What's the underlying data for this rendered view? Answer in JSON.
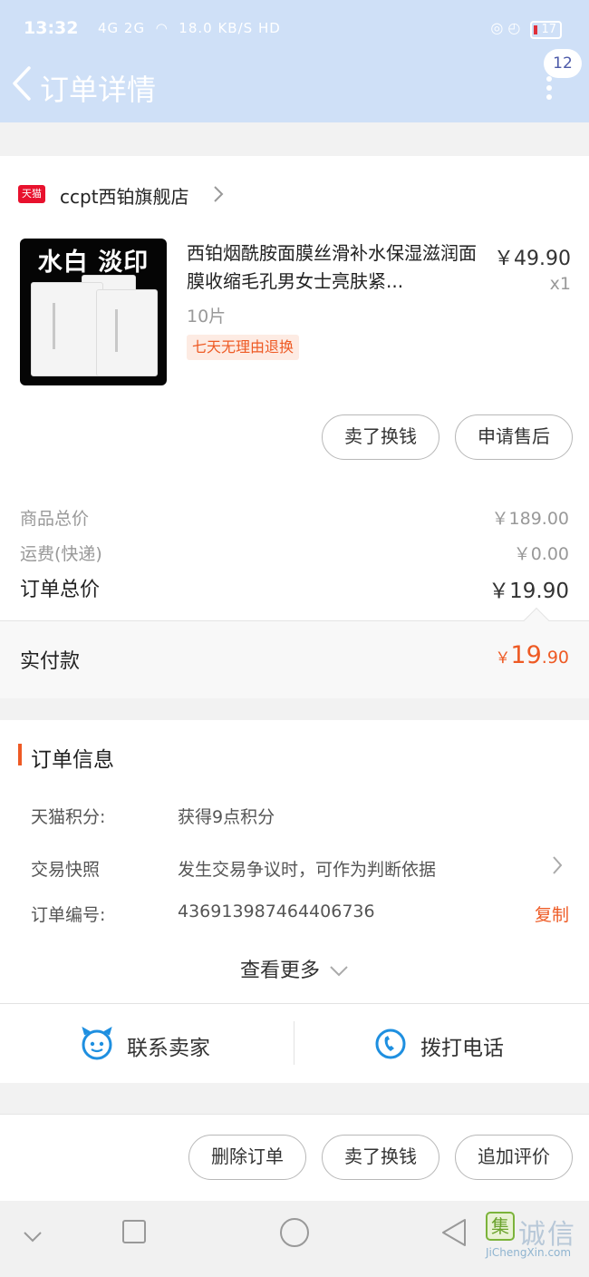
{
  "status_bar": {
    "time": "13:32",
    "signal": "4G 2G",
    "net_speed": "18.0 KB/S",
    "hd": "HD",
    "battery": "17"
  },
  "nav": {
    "title": "订单详情",
    "badge": "12"
  },
  "store": {
    "logo_text": "天猫",
    "name": "ccpt西铂旗舰店"
  },
  "product": {
    "image_title": "水白 淡印",
    "title": "西铂烟酰胺面膜丝滑补水保湿滋润面膜收缩毛孔男女士亮肤紧...",
    "price": "￥49.90",
    "qty": "x1",
    "sku": "10片",
    "tag": "七天无理由退换"
  },
  "item_actions": {
    "sell": "卖了换钱",
    "after_sale": "申请售后"
  },
  "summary": {
    "goods_label": "商品总价",
    "goods_value": "￥189.00",
    "shipping_label": "运费(快递)",
    "shipping_value": "￥0.00",
    "total_label": "订单总价",
    "total_value": "￥19.90"
  },
  "paid": {
    "label": "实付款",
    "currency": "￥",
    "int": "19",
    "dec": ".90"
  },
  "order_info": {
    "title": "订单信息",
    "points_label": "天猫积分:",
    "points_value": "获得9点积分",
    "snapshot_label": "交易快照",
    "snapshot_value": "发生交易争议时，可作为判断依据",
    "order_no_label": "订单编号:",
    "order_no_value": "436913987464406736",
    "copy": "复制",
    "see_more": "查看更多",
    "contact_seller": "联系卖家",
    "call": "拨打电话"
  },
  "bottom_actions": {
    "delete": "删除订单",
    "sell": "卖了换钱",
    "review": "追加评价"
  },
  "watermark": {
    "mark": "集",
    "cn": "诚信",
    "en": "JiChengXin.com"
  },
  "colors": {
    "header_bg": "#cfe0f7",
    "accent_orange": "#ee5a24",
    "tmall_red": "#e8112d",
    "icon_blue": "#1e8fe0"
  }
}
